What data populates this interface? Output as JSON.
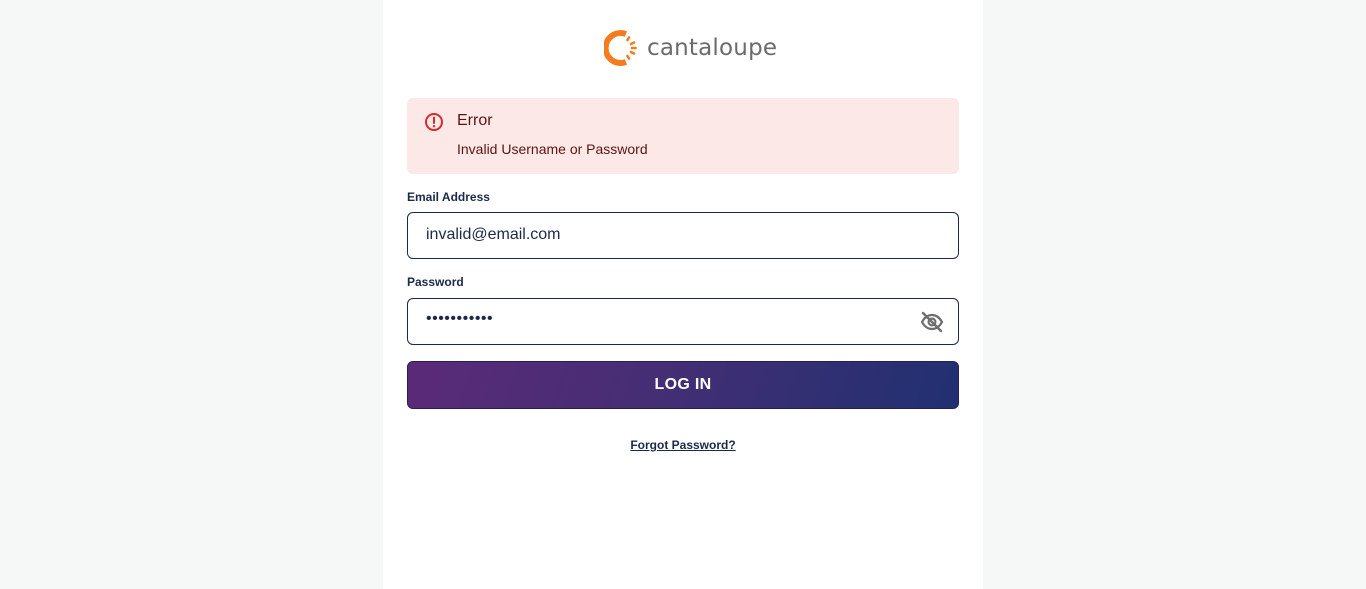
{
  "brand": {
    "name": "cantaloupe",
    "logo_icon": "cantaloupe-sun-icon",
    "logo_color": "#f47b20"
  },
  "alert": {
    "icon": "error-circle-icon",
    "title": "Error",
    "message": "Invalid Username or Password",
    "background": "#fde8e8",
    "icon_color": "#d62b2b"
  },
  "form": {
    "email_label": "Email Address",
    "email_value": "invalid@email.com",
    "password_label": "Password",
    "password_value": "•••••••••••",
    "password_toggle_icon": "eye-off-icon",
    "login_label": "LOG IN",
    "forgot_label": "Forgot Password?"
  },
  "colors": {
    "text_dark": "#1b2a4a",
    "button_gradient_start": "#5b2a78",
    "button_gradient_end": "#203072"
  }
}
